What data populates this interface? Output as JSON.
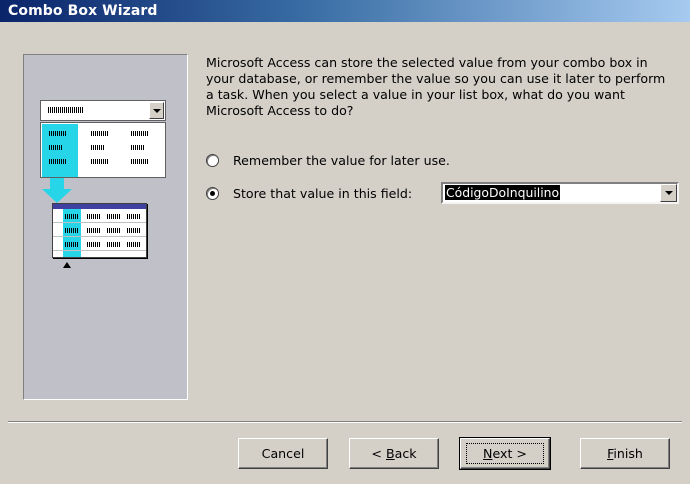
{
  "window": {
    "title": "Combo Box Wizard"
  },
  "instructions": "Microsoft Access can store the selected value from your combo box in your database, or remember the value so you can use it later to perform a task.  When you select a value in your list box, what do you want Microsoft Access to do?",
  "options": [
    {
      "label": "Remember the value for later use.",
      "selected": false
    },
    {
      "label": "Store that value in this field:",
      "selected": true
    }
  ],
  "field_combo": {
    "value": "CódigoDoInquilino",
    "icon": "chevron-down-icon"
  },
  "buttons": {
    "cancel": "Cancel",
    "back_prefix": "< ",
    "back_hotkey": "B",
    "back_rest": "ack",
    "next_hotkey": "N",
    "next_rest": "ext >",
    "finish_hotkey": "F",
    "finish_rest": "inish"
  },
  "colors": {
    "title_start": "#0a246a",
    "title_end": "#a6caf0",
    "dialog_bg": "#d4d0c8",
    "highlight": "#26d6e8"
  }
}
